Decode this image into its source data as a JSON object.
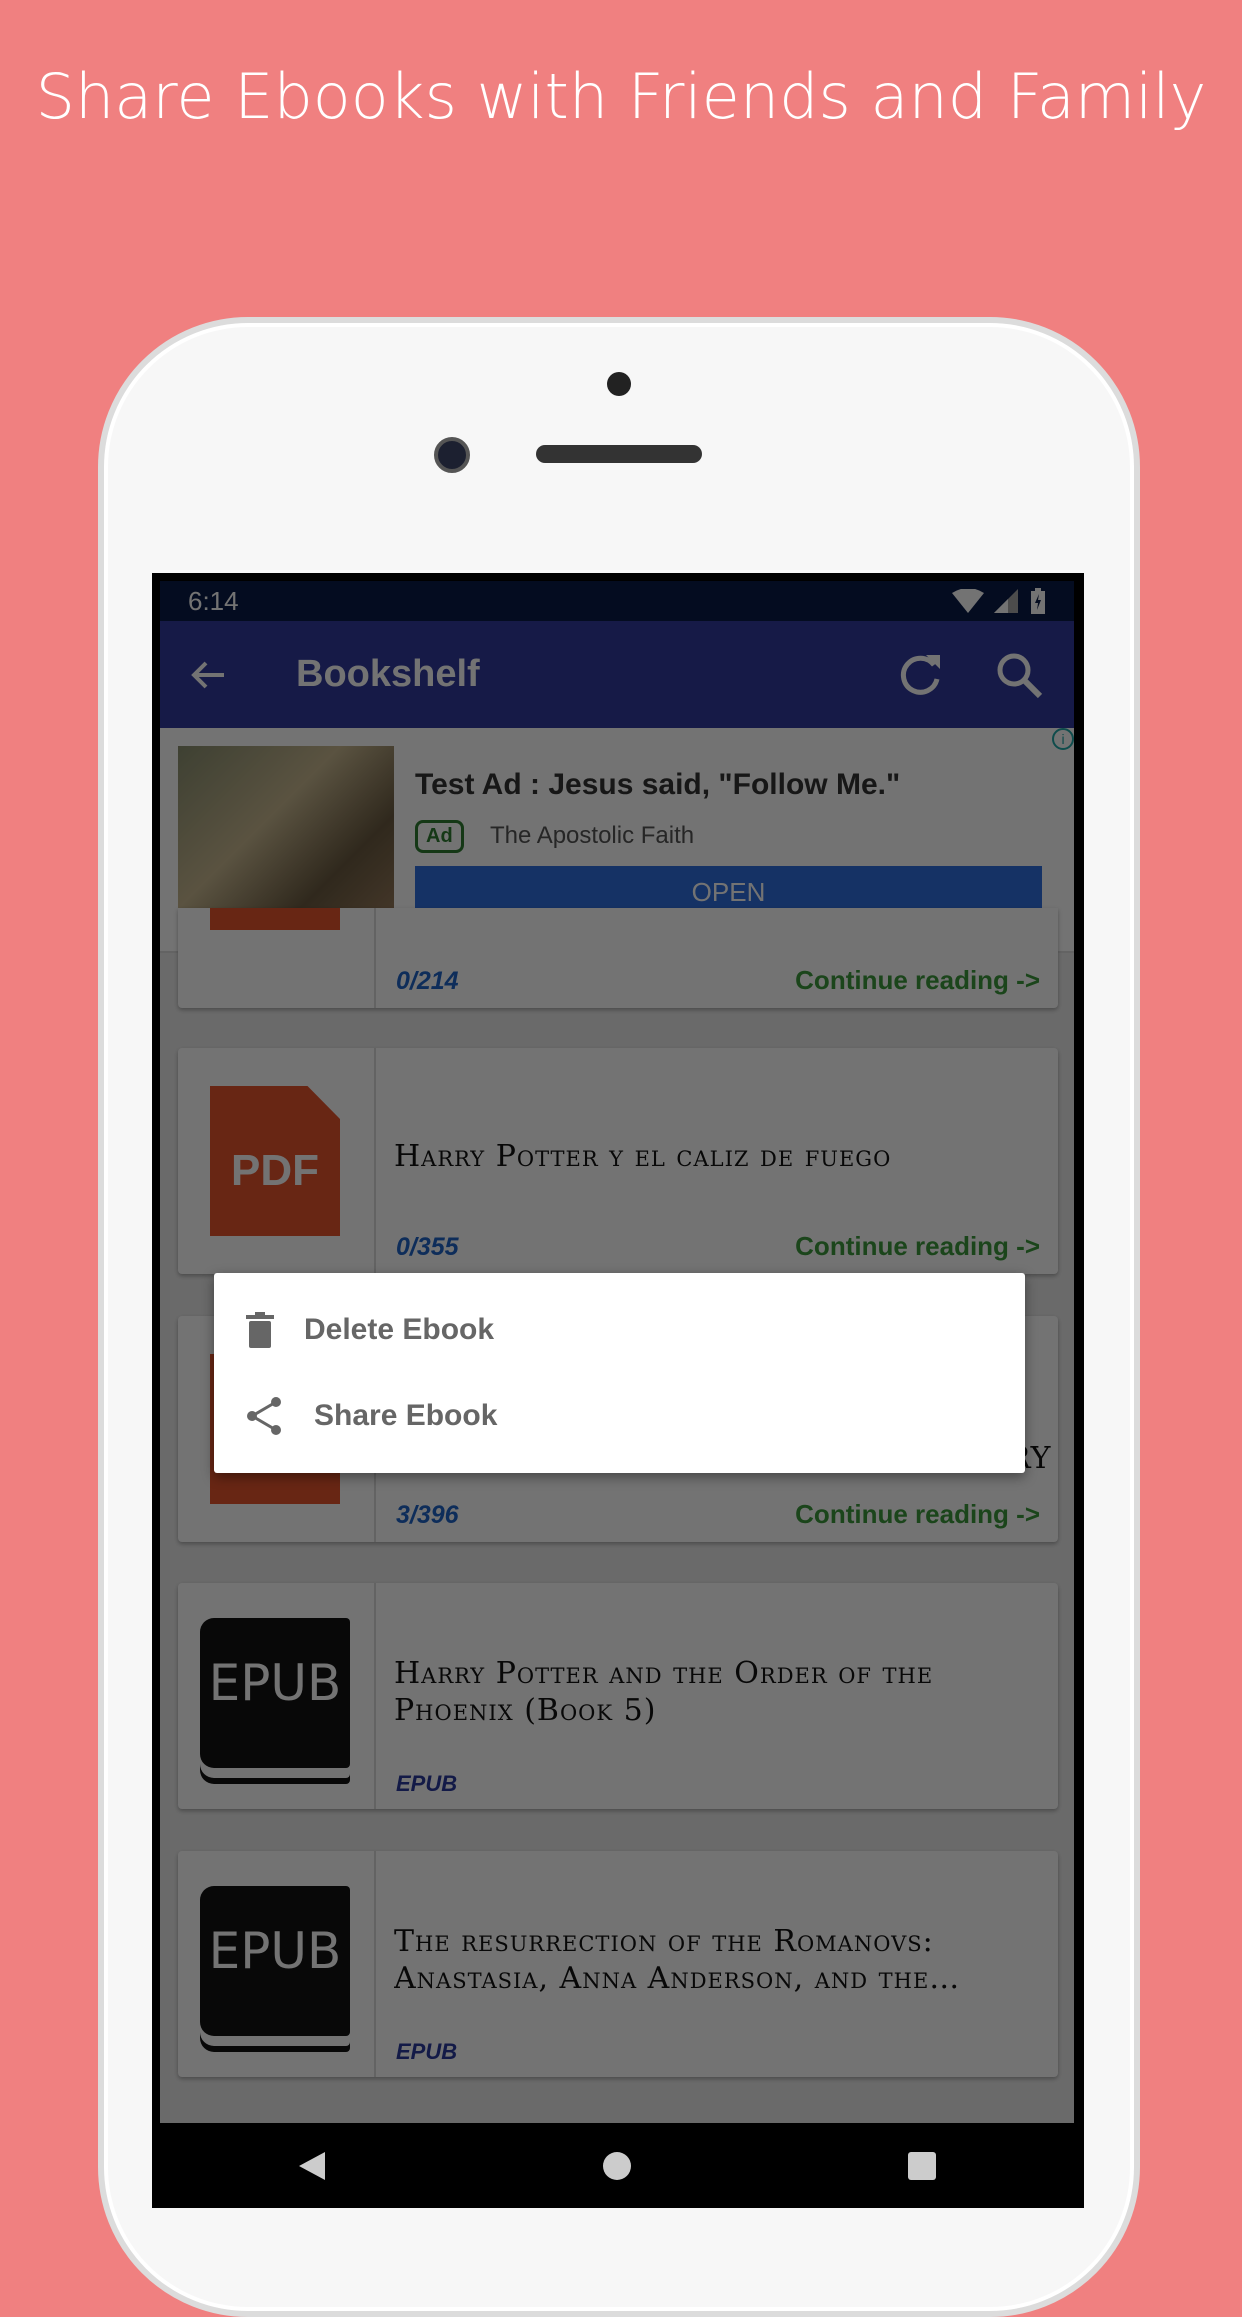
{
  "headline": "Share Ebooks with Friends and Family",
  "colors": {
    "background": "#f08080",
    "appbar": "#303a9e",
    "progress": "#1e63c8",
    "continue": "#3d9a3d"
  },
  "status": {
    "time": "6:14",
    "icons": [
      "wifi-icon",
      "signal-icon",
      "battery-icon"
    ]
  },
  "appbar": {
    "title": "Bookshelf",
    "icons": [
      "back-arrow-icon",
      "refresh-icon",
      "search-icon"
    ]
  },
  "ad": {
    "title": "Test Ad : Jesus said, \"Follow Me.\"",
    "badge": "Ad",
    "source": "The Apostolic Faith",
    "button": "OPEN",
    "info": "i"
  },
  "books": [
    {
      "title": "",
      "type": "PDF",
      "progress": "0/214",
      "action": "Continue reading ->"
    },
    {
      "title": "Harry Potter y el caliz de fuego",
      "type": "PDF",
      "progress": "0/355",
      "action": "Continue reading ->"
    },
    {
      "title": "RY",
      "type": "PDF",
      "progress": "3/396",
      "action": "Continue reading ->"
    },
    {
      "title": "Harry Potter and the Order of the Phoenix (Book 5)",
      "type": "EPUB",
      "progress": "EPUB"
    },
    {
      "title": "The resurrection of the Romanovs: Anastasia, Anna Anderson, and the World's Greatest Royal Mystery",
      "type": "EPUB",
      "progress": "EPUB"
    }
  ],
  "menu": {
    "items": [
      {
        "label": "Delete Ebook",
        "icon": "trash-icon"
      },
      {
        "label": "Share Ebook",
        "icon": "share-icon"
      }
    ]
  }
}
